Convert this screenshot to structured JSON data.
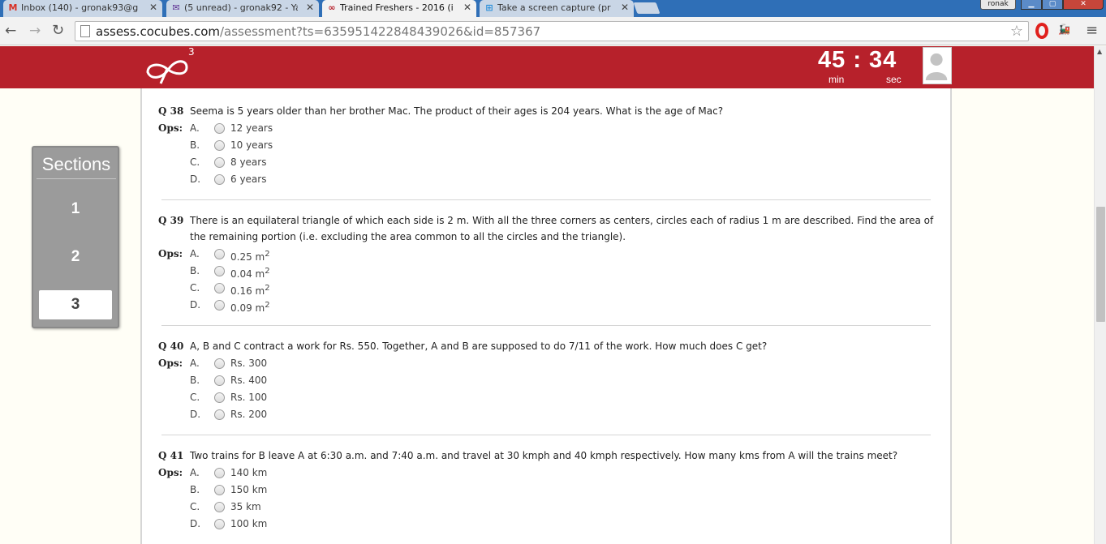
{
  "browser": {
    "tabs": [
      {
        "title": "Inbox (140) - gronak93@g",
        "icon": "gmail-icon",
        "active": false
      },
      {
        "title": "(5 unread) - gronak92 - Ya",
        "icon": "yahoo-mail-icon",
        "active": false
      },
      {
        "title": "Trained Freshers - 2016 (i",
        "icon": "cocubes-icon",
        "active": true
      },
      {
        "title": "Take a screen capture (pri",
        "icon": "windows-icon",
        "active": false
      }
    ],
    "profile": "ronak",
    "url_host": "assess.cocubes.com",
    "url_path": "/assessment?ts=635951422848439026&id=857367"
  },
  "header": {
    "logo_superscript": "3",
    "timer_value": "45 : 34",
    "timer_min_label": "min",
    "timer_sec_label": "sec"
  },
  "sidebar": {
    "title": "Sections",
    "items": [
      {
        "label": "1",
        "active": false
      },
      {
        "label": "2",
        "active": false
      },
      {
        "label": "3",
        "active": true
      }
    ]
  },
  "ops_label": "Ops:",
  "questions": [
    {
      "number": "Q 38",
      "text": "Seema is 5 years older than her brother Mac. The product of their ages is 204 years. What is the age of Mac?",
      "options": [
        {
          "letter": "A.",
          "text": "12 years"
        },
        {
          "letter": "B.",
          "text": "10 years"
        },
        {
          "letter": "C.",
          "text": "8 years"
        },
        {
          "letter": "D.",
          "text": "6 years"
        }
      ]
    },
    {
      "number": "Q 39",
      "text": "There is an equilateral triangle of which each side is 2 m. With all the three corners as centers, circles each of radius 1 m are described. Find the area of the remaining portion (i.e. excluding the area common to all the circles and the triangle).",
      "options": [
        {
          "letter": "A.",
          "text": "0.25 m",
          "sup": "2"
        },
        {
          "letter": "B.",
          "text": "0.04 m",
          "sup": "2"
        },
        {
          "letter": "C.",
          "text": "0.16 m",
          "sup": "2"
        },
        {
          "letter": "D.",
          "text": "0.09 m",
          "sup": "2"
        }
      ]
    },
    {
      "number": "Q 40",
      "text": "A, B and C contract a work for Rs. 550. Together, A and B are supposed to do 7/11 of the work. How much does C get?",
      "options": [
        {
          "letter": "A.",
          "text": "Rs. 300"
        },
        {
          "letter": "B.",
          "text": "Rs. 400"
        },
        {
          "letter": "C.",
          "text": "Rs. 100"
        },
        {
          "letter": "D.",
          "text": "Rs. 200"
        }
      ]
    },
    {
      "number": "Q 41",
      "text": "Two trains for B leave A at 6:30 a.m. and 7:40 a.m. and travel at 30 kmph and 40 kmph respectively. How many kms from A will the trains meet?",
      "options": [
        {
          "letter": "A.",
          "text": "140 km"
        },
        {
          "letter": "B.",
          "text": "150 km"
        },
        {
          "letter": "C.",
          "text": "35 km"
        },
        {
          "letter": "D.",
          "text": "100 km"
        }
      ]
    }
  ],
  "colors": {
    "brand_red": "#b7212b",
    "sections_grey": "#9b9b9b"
  }
}
